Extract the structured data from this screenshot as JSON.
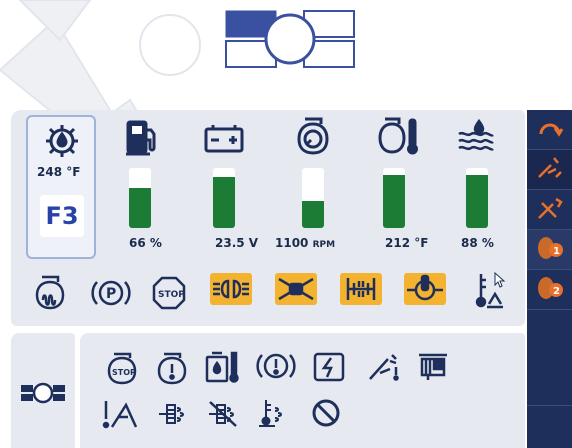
{
  "screen": {
    "background": "#ffffff",
    "panel_color": "#e6e9f0",
    "icon_color": "#1f2f5b",
    "bar_color": "#1c7c36",
    "warning_color": "#f3b330"
  },
  "header": {
    "logo_icon": "joystick-logo-icon"
  },
  "gauges": {
    "oil_temp": {
      "icon": "oil-temperature-icon",
      "value": "248 °F"
    },
    "gear": {
      "label": "F3"
    },
    "fuel": {
      "icon": "fuel-icon",
      "value": "66 %",
      "level": 0.66
    },
    "battery": {
      "icon": "battery-icon",
      "value": "23.5 V",
      "level": 0.85
    },
    "engine_speed": {
      "icon": "engine-speed-icon",
      "value": "1100",
      "unit": "RPM",
      "level": 0.45
    },
    "coolant_temp": {
      "icon": "coolant-temperature-icon",
      "value": "212 °F",
      "level": 0.88
    },
    "def_level": {
      "icon": "def-fluid-icon",
      "value": "88 %",
      "level": 0.88
    }
  },
  "status_icons": [
    {
      "name": "glow-plug-icon",
      "active": false
    },
    {
      "name": "parking-brake-icon",
      "active": false
    },
    {
      "name": "engine-stop-icon",
      "active": false
    },
    {
      "name": "headlights-icon",
      "active": true
    },
    {
      "name": "differential-lock-icon",
      "active": true
    },
    {
      "name": "axle-lock-icon",
      "active": true
    },
    {
      "name": "transmission-temperature-icon",
      "active": true
    },
    {
      "name": "hydraulic-temperature-icon",
      "active": false
    }
  ],
  "lower_panel": {
    "left_icon": "transmission-mode-icon",
    "row1": [
      "engine-stop-warning-icon",
      "engine-warning-icon",
      "hydraulic-oil-temp-icon",
      "brake-warning-icon",
      "charging-system-icon",
      "boom-float-icon",
      "service-indicator-icon"
    ],
    "row2": [
      "machine-alert-icon",
      "regen-inhibit-icon",
      "regen-disabled-icon",
      "exhaust-temperature-icon",
      "prohibited-icon"
    ]
  },
  "sidebar": {
    "buttons": [
      "auto-shutdown-icon",
      "tilt-icon",
      "boom-icon",
      "fan-speed-1-icon",
      "fan-speed-2-icon",
      "blank-1",
      "blank-2"
    ]
  }
}
